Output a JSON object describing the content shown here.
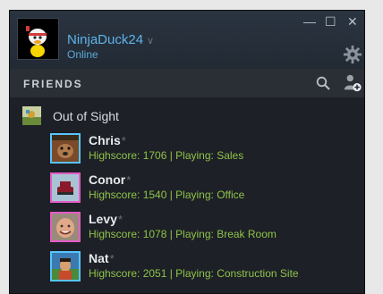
{
  "profile": {
    "username": "NinjaDuck24",
    "status": "Online",
    "avatar_icon": "ninja-duck-avatar"
  },
  "window_controls": {
    "minimize": "—",
    "maximize": "☐",
    "close": "✕"
  },
  "friends_section": {
    "label": "FRIENDS"
  },
  "group": {
    "label": "Out of Sight",
    "icon": "group-icon"
  },
  "friends": [
    {
      "name": "Chris",
      "marker": "*",
      "status": "Highscore: 1706 | Playing: Sales",
      "avatar_color": "#8a5a3a"
    },
    {
      "name": "Conor",
      "marker": "*",
      "status": "Highscore: 1540 | Playing: Office",
      "avatar_color": "#9fb8c8"
    },
    {
      "name": "Levy",
      "marker": "*",
      "status": "Highscore: 1078 | Playing: Break Room",
      "avatar_color": "#c89070"
    },
    {
      "name": "Nat",
      "marker": "*",
      "status": "Highscore: 2051 | Playing: Construction Site",
      "avatar_color": "#3a6aa0"
    }
  ],
  "colors": {
    "accent": "#5eb3ea",
    "ingame": "#8fc24a",
    "panel": "#1d2026"
  }
}
